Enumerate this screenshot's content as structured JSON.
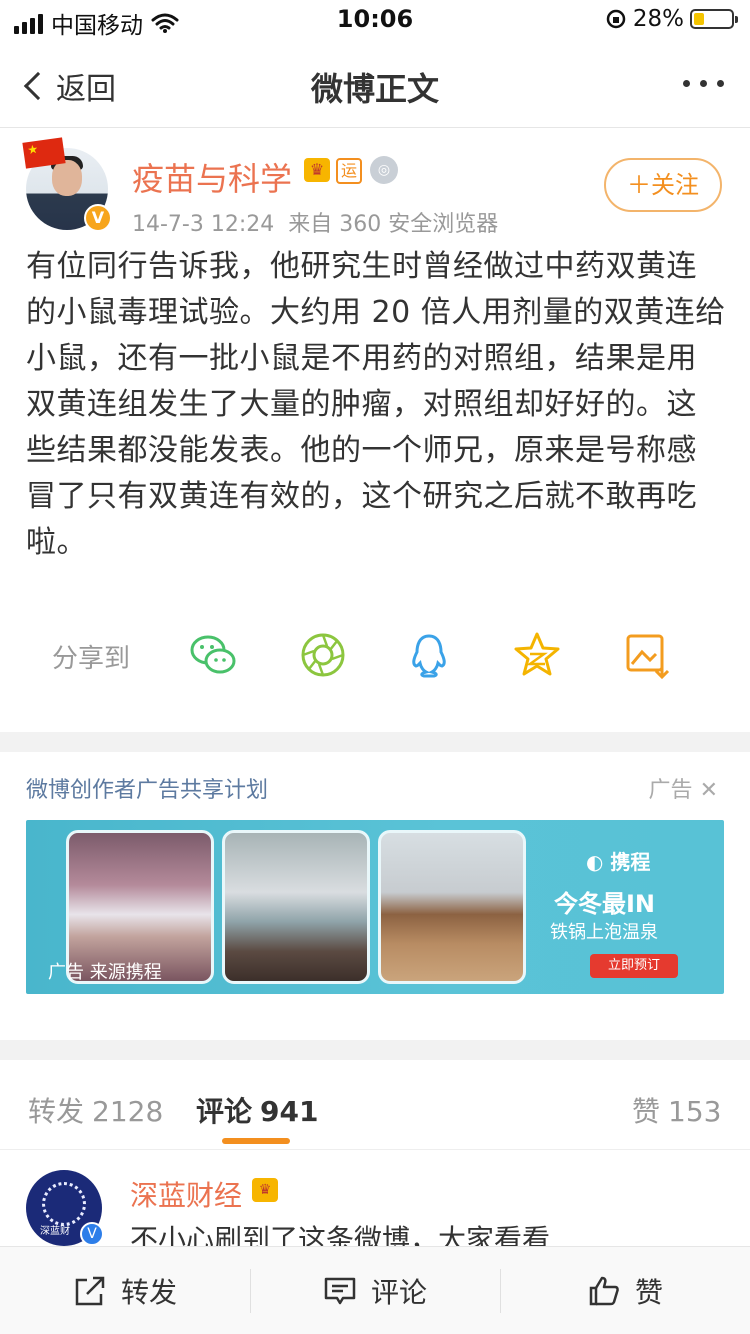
{
  "status_bar": {
    "carrier": "中国移动",
    "time": "10:06",
    "battery": "28%",
    "battery_level": 0.28
  },
  "nav": {
    "back_label": "返回",
    "title": "微博正文"
  },
  "post": {
    "author": "疫苗与科学",
    "badge_yun": "运",
    "verified_badge": "V",
    "date": "14-7-3 12:24",
    "source": "来自 360 安全浏览器",
    "follow_label": "＋关注",
    "body": "有位同行告诉我，他研究生时曾经做过中药双黄连的小鼠毒理试验。大约用 20 倍人用剂量的双黄连给小鼠，还有一批小鼠是不用药的对照组，结果是用双黄连组发生了大量的肿瘤，对照组却好好的。这些结果都没能发表。他的一个师兄，原来是号称感冒了只有双黄连有效的，这个研究之后就不敢再吃啦。"
  },
  "share": {
    "label": "分享到",
    "icons": [
      "wechat-icon",
      "moments-icon",
      "qq-icon",
      "qzone-icon",
      "save-image-icon"
    ]
  },
  "ad": {
    "title": "微博创作者广告共享计划",
    "mark": "广告",
    "source_label": "广告 来源携程",
    "brand": "携程",
    "headline": "今冬最IN",
    "subline": "铁锅上泡温泉",
    "cta": "立即预订"
  },
  "tabs": [
    {
      "label": "转发",
      "count": "2128"
    },
    {
      "label": "评论",
      "count": "941"
    },
    {
      "label": "赞",
      "count": "153"
    }
  ],
  "comment": {
    "author": "深蓝财经",
    "avatar_text": "深蓝财",
    "text": "不小心刷到了这条微博，大家看看"
  },
  "bottom_bar": {
    "repost": "转发",
    "comment": "评论",
    "like": "赞"
  },
  "colors": {
    "accent_orange": "#f38f1f",
    "name_orange": "#eb7350",
    "ad_blue": "#4fb9cf",
    "link_blue": "#5d7aa0"
  }
}
